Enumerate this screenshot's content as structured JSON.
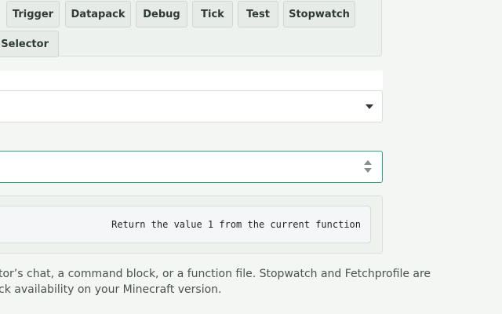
{
  "command_buttons": [
    {
      "label": "Trigger"
    },
    {
      "label": "Datapack"
    },
    {
      "label": "Debug"
    },
    {
      "label": "Tick"
    },
    {
      "label": "Test"
    },
    {
      "label": "Stopwatch"
    },
    {
      "label": "et Selector"
    }
  ],
  "output": {
    "text": "Return the value 1 from the current function"
  },
  "help": {
    "line1": "tor’s chat, a command block, or a function file. Stopwatch and Fetchprofile are",
    "line2": "ck availability on your Minecraft version."
  }
}
